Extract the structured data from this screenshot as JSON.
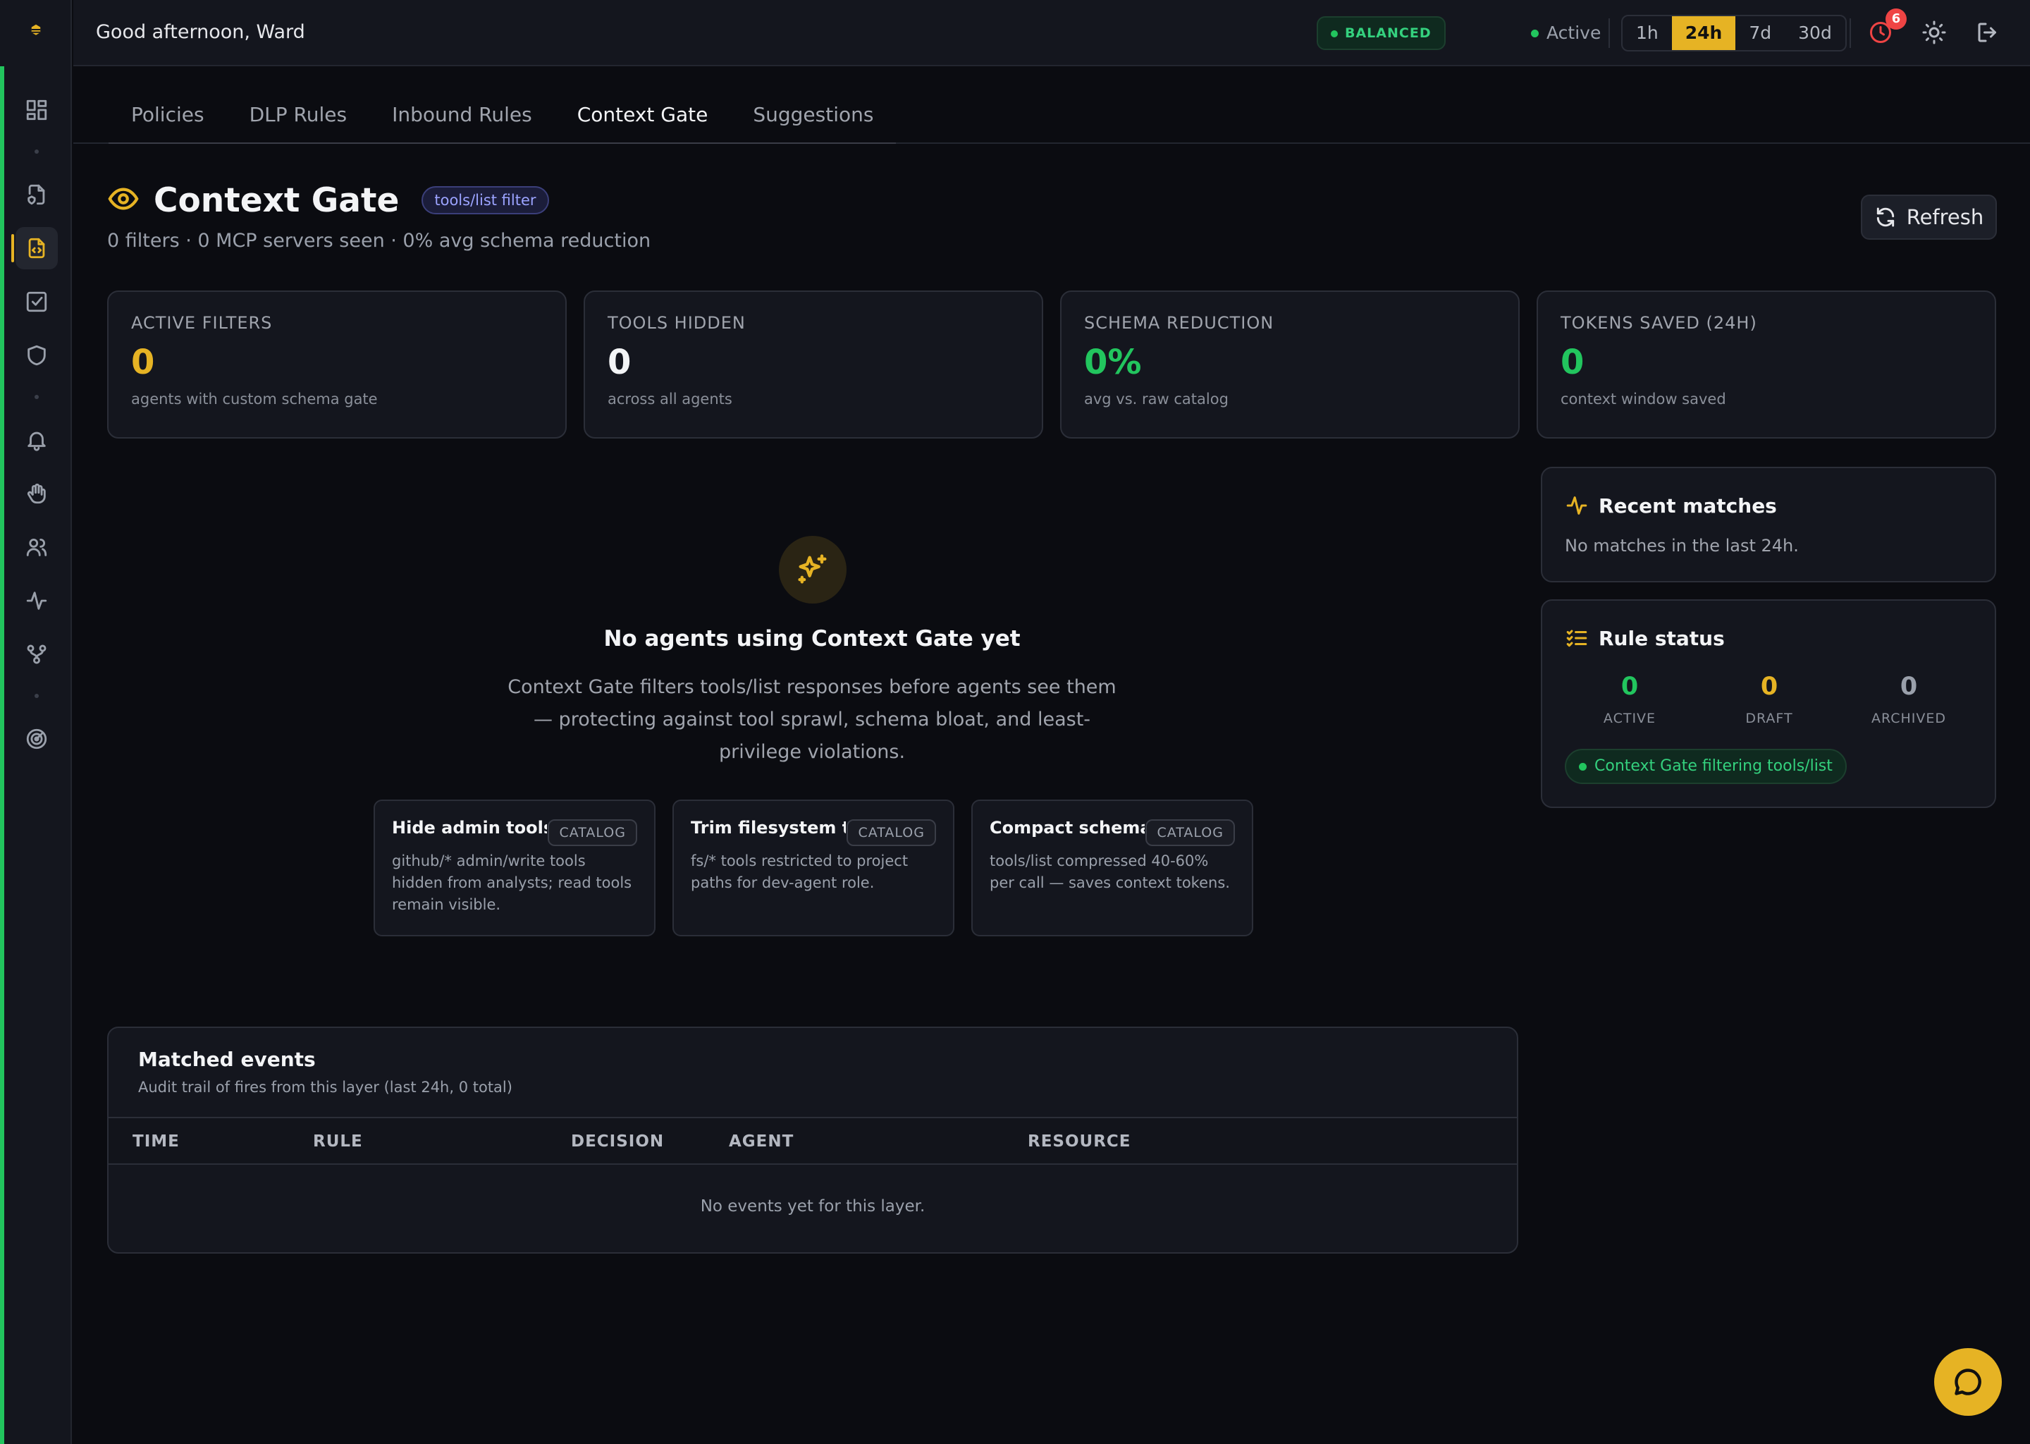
{
  "colors": {
    "accent": "#e6b324",
    "green": "#22c55e",
    "danger": "#ef4444",
    "muted": "#9aa0ab"
  },
  "sidebar": {
    "logo_icon": "bee-logo-icon",
    "items": [
      {
        "icon": "dashboard-icon"
      },
      {
        "icon": "document-shield-icon"
      },
      {
        "icon": "document-code-icon"
      },
      {
        "icon": "checkbox-icon"
      },
      {
        "icon": "shield-icon"
      },
      {
        "icon": "bell-icon"
      },
      {
        "icon": "hand-icon"
      },
      {
        "icon": "users-icon"
      },
      {
        "icon": "activity-icon"
      },
      {
        "icon": "git-branch-icon"
      },
      {
        "icon": "radar-icon"
      }
    ]
  },
  "topbar": {
    "greeting": "Good afternoon, Ward",
    "mode_badge": "BALANCED",
    "status": "Active",
    "ranges": [
      "1h",
      "24h",
      "7d",
      "30d"
    ],
    "selected_range": "24h",
    "notification_count": "6"
  },
  "tabs": [
    "Policies",
    "DLP Rules",
    "Inbound Rules",
    "Context Gate",
    "Suggestions"
  ],
  "current_tab": "Context Gate",
  "header": {
    "title": "Context Gate",
    "tag": "tools/list filter",
    "subtitle": "0 filters · 0 MCP servers seen · 0% avg schema reduction",
    "refresh_label": "Refresh"
  },
  "stats": [
    {
      "label": "ACTIVE FILTERS",
      "value": "0",
      "desc": "agents with custom schema gate",
      "color": "#e6b324"
    },
    {
      "label": "TOOLS HIDDEN",
      "value": "0",
      "desc": "across all agents",
      "color": "#f3f4f6"
    },
    {
      "label": "SCHEMA REDUCTION",
      "value": "0%",
      "desc": "avg vs. raw catalog",
      "color": "#22c55e"
    },
    {
      "label": "TOKENS SAVED (24H)",
      "value": "0",
      "desc": "context window saved",
      "color": "#22c55e"
    }
  ],
  "empty_state": {
    "title": "No agents using Context Gate yet",
    "description": "Context Gate filters tools/list responses before agents see them — protecting against tool sprawl, schema bloat, and least-privilege violations.",
    "examples": [
      {
        "title": "Hide admin tools ...",
        "tag": "CATALOG",
        "desc": "github/* admin/write tools hidden from analysts; read tools remain visible."
      },
      {
        "title": "Trim filesystem t...",
        "tag": "CATALOG",
        "desc": "fs/* tools restricted to project paths for dev-agent role."
      },
      {
        "title": "Compact schema...",
        "tag": "CATALOG",
        "desc": "tools/list compressed 40-60% per call — saves context tokens."
      }
    ]
  },
  "recent_matches": {
    "title": "Recent matches",
    "text": "No matches in the last 24h."
  },
  "rule_status": {
    "title": "Rule status",
    "counts": [
      {
        "value": "0",
        "label": "ACTIVE",
        "color": "#22c55e"
      },
      {
        "value": "0",
        "label": "DRAFT",
        "color": "#e6b324"
      },
      {
        "value": "0",
        "label": "ARCHIVED",
        "color": "#9aa0ab"
      }
    ],
    "pill": "Context Gate filtering tools/list"
  },
  "events": {
    "title": "Matched events",
    "subtitle": "Audit trail of fires from this layer (last 24h, 0 total)",
    "columns": [
      "TIME",
      "RULE",
      "DECISION",
      "AGENT",
      "RESOURCE"
    ],
    "empty": "No events yet for this layer."
  }
}
